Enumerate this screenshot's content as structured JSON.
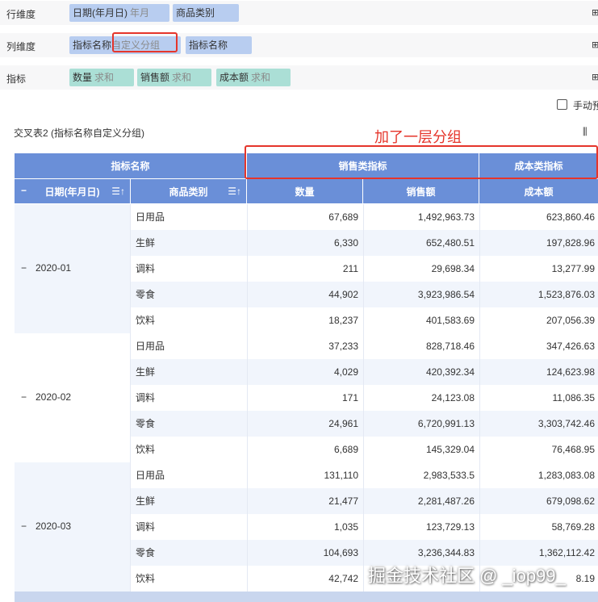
{
  "config": {
    "row_dim": {
      "label": "行维度",
      "pills": [
        {
          "name": "日期(年月日)",
          "sub": "年月"
        },
        {
          "name": "商品类别",
          "sub": ""
        }
      ]
    },
    "col_dim": {
      "label": "列维度",
      "pills": [
        {
          "name": "指标名称",
          "sub": "自定义分组"
        },
        {
          "name": "指标名称",
          "sub": ""
        }
      ]
    },
    "indicators": {
      "label": "指标",
      "pills": [
        {
          "name": "数量",
          "sub": "求和"
        },
        {
          "name": "销售额",
          "sub": "求和"
        },
        {
          "name": "成本额",
          "sub": "求和"
        }
      ]
    },
    "edge_icon": "⊞"
  },
  "manual_checkbox": {
    "label": "手动预",
    "checked": false
  },
  "table": {
    "title": "交叉表2 (指标名称自定义分组)",
    "menu_icon": "⫼",
    "annotation": "加了一层分组",
    "header": {
      "metric_name": "指标名称",
      "group_sales": "销售类指标",
      "group_cost": "成本类指标",
      "date_col": "日期(年月日)",
      "category_col": "商品类别",
      "qty_col": "数量",
      "sales_col": "销售额",
      "cost_col": "成本额",
      "collapse_icon": "−",
      "sort_icon": "☰↑"
    },
    "groups": [
      {
        "date": "2020-01",
        "rows": [
          {
            "cat": "日用品",
            "qty": "67,689",
            "sales": "1,492,963.73",
            "cost": "623,860.46"
          },
          {
            "cat": "生鲜",
            "qty": "6,330",
            "sales": "652,480.51",
            "cost": "197,828.96"
          },
          {
            "cat": "调料",
            "qty": "211",
            "sales": "29,698.34",
            "cost": "13,277.99"
          },
          {
            "cat": "零食",
            "qty": "44,902",
            "sales": "3,923,986.54",
            "cost": "1,523,876.03"
          },
          {
            "cat": "饮料",
            "qty": "18,237",
            "sales": "401,583.69",
            "cost": "207,056.39"
          }
        ]
      },
      {
        "date": "2020-02",
        "rows": [
          {
            "cat": "日用品",
            "qty": "37,233",
            "sales": "828,718.46",
            "cost": "347,426.63"
          },
          {
            "cat": "生鲜",
            "qty": "4,029",
            "sales": "420,392.34",
            "cost": "124,623.98"
          },
          {
            "cat": "调料",
            "qty": "171",
            "sales": "24,123.08",
            "cost": "11,086.35"
          },
          {
            "cat": "零食",
            "qty": "24,961",
            "sales": "6,720,991.13",
            "cost": "3,303,742.46"
          },
          {
            "cat": "饮料",
            "qty": "6,689",
            "sales": "145,329.04",
            "cost": "76,468.95"
          }
        ]
      },
      {
        "date": "2020-03",
        "rows": [
          {
            "cat": "日用品",
            "qty": "131,110",
            "sales": "2,983,533.5",
            "cost": "1,283,083.08"
          },
          {
            "cat": "生鲜",
            "qty": "21,477",
            "sales": "2,281,487.26",
            "cost": "679,098.62"
          },
          {
            "cat": "调料",
            "qty": "1,035",
            "sales": "123,729.13",
            "cost": "58,769.28"
          },
          {
            "cat": "零食",
            "qty": "104,693",
            "sales": "3,236,344.83",
            "cost": "1,362,112.42"
          },
          {
            "cat": "饮料",
            "qty": "42,742",
            "sales": "",
            "cost": "8.19"
          }
        ]
      }
    ]
  },
  "watermark": "掘金技术社区 @ _iop99_",
  "colors": {
    "header_blue": "#6a8fd8",
    "dim_pill": "#b8cdf0",
    "indicator_pill": "#abdfd6",
    "annotation_red": "#e5352b"
  }
}
